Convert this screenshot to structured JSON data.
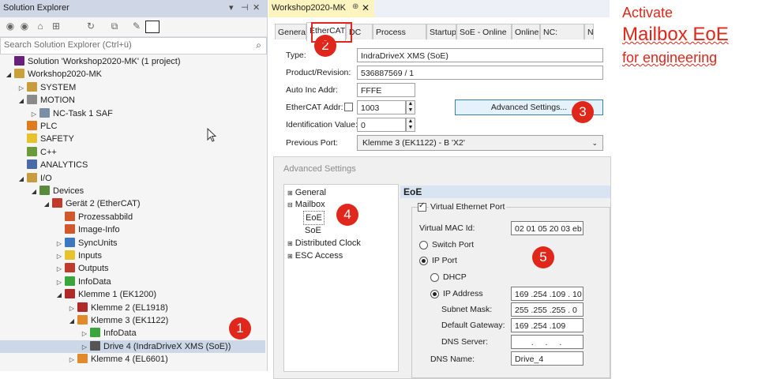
{
  "solution_explorer": {
    "title": "Solution Explorer",
    "title_controls": [
      "▾",
      "⊣",
      "✕"
    ],
    "search_placeholder": "Search Solution Explorer (Ctrl+ü)",
    "tree": [
      {
        "label": "Solution 'Workshop2020-MK' (1 project)",
        "level": 0,
        "exp": "",
        "icon": "solution-icon",
        "color": "#68217a"
      },
      {
        "label": "Workshop2020-MK",
        "level": 0,
        "exp": "◢",
        "icon": "project-icon",
        "color": "#c9a13a"
      },
      {
        "label": "SYSTEM",
        "level": 1,
        "exp": "▷",
        "icon": "system-icon",
        "color": "#c89b3c"
      },
      {
        "label": "MOTION",
        "level": 1,
        "exp": "◢",
        "icon": "motion-icon",
        "color": "#8a8a8a"
      },
      {
        "label": "NC-Task 1 SAF",
        "level": 2,
        "exp": "▷",
        "icon": "nc-task-icon",
        "color": "#7a8ea8"
      },
      {
        "label": "PLC",
        "level": 1,
        "exp": "",
        "icon": "plc-icon",
        "color": "#e07a1f"
      },
      {
        "label": "SAFETY",
        "level": 1,
        "exp": "",
        "icon": "safety-icon",
        "color": "#e8c22a"
      },
      {
        "label": "C++",
        "level": 1,
        "exp": "",
        "icon": "cpp-icon",
        "color": "#6b9a3c"
      },
      {
        "label": "ANALYTICS",
        "level": 1,
        "exp": "",
        "icon": "analytics-icon",
        "color": "#4a6aa8"
      },
      {
        "label": "I/O",
        "level": 1,
        "exp": "◢",
        "icon": "io-icon",
        "color": "#c89b3c"
      },
      {
        "label": "Devices",
        "level": 2,
        "exp": "◢",
        "icon": "devices-icon",
        "color": "#5a8a3c"
      },
      {
        "label": "Gerät 2 (EtherCAT)",
        "level": 3,
        "exp": "◢",
        "icon": "ethercat-device-icon",
        "color": "#c0392b"
      },
      {
        "label": "Prozessabbild",
        "level": 4,
        "exp": "",
        "icon": "process-image-icon",
        "color": "#d0582a"
      },
      {
        "label": "Image-Info",
        "level": 4,
        "exp": "",
        "icon": "image-info-icon",
        "color": "#d0582a"
      },
      {
        "label": "SyncUnits",
        "level": 4,
        "exp": "▷",
        "icon": "syncunits-icon",
        "color": "#3a78c2"
      },
      {
        "label": "Inputs",
        "level": 4,
        "exp": "▷",
        "icon": "inputs-icon",
        "color": "#e8c22a"
      },
      {
        "label": "Outputs",
        "level": 4,
        "exp": "▷",
        "icon": "outputs-icon",
        "color": "#c0392b"
      },
      {
        "label": "InfoData",
        "level": 4,
        "exp": "▷",
        "icon": "infodata-icon",
        "color": "#3aa53a"
      },
      {
        "label": "Klemme 1 (EK1200)",
        "level": 4,
        "exp": "◢",
        "icon": "terminal-icon",
        "color": "#b02a2a"
      },
      {
        "label": "Klemme 2 (EL1918)",
        "level": 5,
        "exp": "▷",
        "icon": "terminal-icon",
        "color": "#b02a2a"
      },
      {
        "label": "Klemme 3 (EK1122)",
        "level": 5,
        "exp": "◢",
        "icon": "terminal-icon",
        "color": "#e08a2a"
      },
      {
        "label": "InfoData",
        "level": 6,
        "exp": "▷",
        "icon": "infodata-icon",
        "color": "#3aa53a"
      },
      {
        "label": "Drive 4 (IndraDriveX XMS (SoE))",
        "level": 6,
        "exp": "▷",
        "icon": "drive-icon",
        "color": "#555555",
        "selected": true
      },
      {
        "label": "Klemme 4 (EL6601)",
        "level": 5,
        "exp": "▷",
        "icon": "terminal-icon",
        "color": "#e08a2a"
      }
    ]
  },
  "document": {
    "tab_title": "Workshop2020-MK",
    "tabs": [
      "General",
      "EtherCAT",
      "DC",
      "Process Data",
      "Startup",
      "SoE - Online",
      "Online",
      "NC: Online",
      "NC"
    ],
    "active_tab": 1,
    "fields": {
      "type_label": "Type:",
      "type_value": "IndraDriveX XMS (SoE)",
      "product_label": "Product/Revision:",
      "product_value": "536887569 / 1",
      "autoinc_label": "Auto Inc Addr:",
      "autoinc_value": "FFFE",
      "ecaddr_label": "EtherCAT Addr:",
      "ecaddr_value": "1003",
      "ident_label": "Identification Value:",
      "ident_value": "0",
      "prevport_label": "Previous Port:",
      "prevport_value": "Klemme 3 (EK1122) - B 'X2'",
      "advanced_button": "Advanced Settings..."
    }
  },
  "advanced": {
    "title": "Advanced Settings",
    "tree": {
      "general": "General",
      "mailbox": "Mailbox",
      "eoe": "EoE",
      "soe": "SoE",
      "distributed_clock": "Distributed Clock",
      "esc_access": "ESC Access"
    },
    "eoe": {
      "header": "EoE",
      "virtual_port_label": "Virtual Ethernet Port",
      "mac_label": "Virtual MAC Id:",
      "mac_value": "02 01 05 20 03 eb",
      "switch_port": "Switch Port",
      "ip_port": "IP Port",
      "dhcp": "DHCP",
      "ip_address_label": "IP Address",
      "ip_address_value": "169 .254 .109 . 10",
      "subnet_label": "Subnet Mask:",
      "subnet_value": "255 .255 .255 . 0",
      "gateway_label": "Default Gateway:",
      "gateway_value": "169 .254 .109 .151",
      "dns_server_label": "DNS Server:",
      "dns_server_value": ". . .",
      "dns_name_label": "DNS Name:",
      "dns_name_value": "Drive_4"
    }
  },
  "annotations": {
    "badges": [
      "1",
      "2",
      "3",
      "4",
      "5"
    ],
    "note_line1": "Activate",
    "note_line2": "Mailbox EoE",
    "note_line3": "for engineering",
    "color": "#e0271b"
  }
}
